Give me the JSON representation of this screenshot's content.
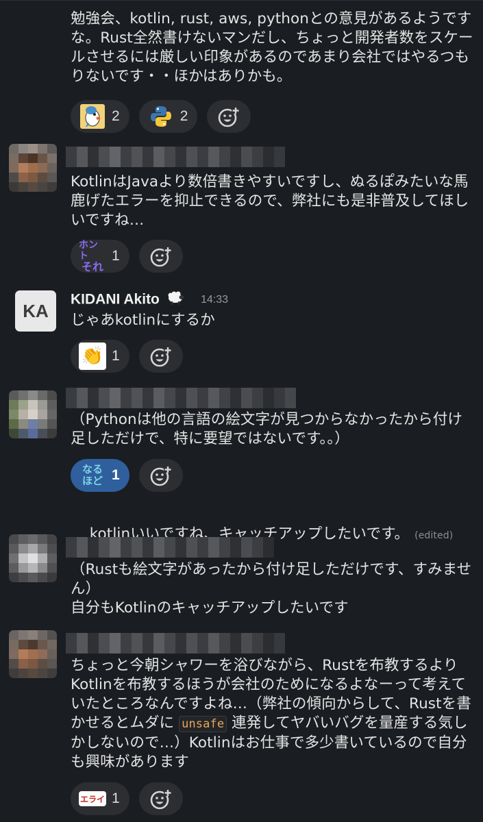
{
  "messages": {
    "m1": {
      "text": "勉強会、kotlin, rust, aws, pythonとの意見があるようですな。Rust全然書けないマンだし、ちょっと開発者数をスケールさせるには厳しい印象があるのであまり会社ではやるつもりないです・・ほかはありかも。",
      "reactions": [
        {
          "emoji": "parrot-emoji",
          "count": "2"
        },
        {
          "emoji": "python-emoji",
          "count": "2"
        }
      ]
    },
    "m2": {
      "text": "KotlinはJavaより数倍書きやすいですし、ぬるぽみたいな馬鹿げたエラーを抑止できるので、弊社にも是非普及してほしいですね…",
      "reactions": [
        {
          "emoji": "honto-sore-emoji",
          "label_line1": "ホント",
          "label_line2": "それ",
          "count": "1"
        }
      ]
    },
    "m3": {
      "avatar_initials": "KA",
      "sender": "KIDANI Akito",
      "time": "14:33",
      "text": "じゃあkotlinにするか",
      "reactions": [
        {
          "emoji": "clap-emoji",
          "glyph": "👏",
          "count": "1"
        }
      ]
    },
    "m4": {
      "text": "（Pythonは他の言語の絵文字が見つからなかったから付け足しただけで、特に要望ではないです。。）",
      "reactions": [
        {
          "emoji": "naruhodo-emoji",
          "label_line1": "なる",
          "label_line2": "ほど",
          "count": "1"
        }
      ],
      "followup_text": "kotlinいいですね、キャッチアップしたいです。",
      "edited_label": "(edited)"
    },
    "m5": {
      "text": "（Rustも絵文字があったから付け足しただけです、すみません）\n自分もKotlinのキャッチアップしたいです"
    },
    "m6": {
      "text_before": "ちょっと今朝シャワーを浴びながら、Rustを布教するよりKotlinを布教するほうが会社のためになるよなーって考えていたところなんですよね…（弊社の傾向からして、Rustを書かせるとムダに",
      "code": "unsafe",
      "text_after": "連発してヤバいバグを量産する気しかしないので…）Kotlinはお仕事で多少書いているので自分も興味があります",
      "reactions": [
        {
          "emoji": "erai-emoji",
          "label": "エライ",
          "count": "1"
        }
      ]
    }
  },
  "icons": {
    "add_reaction": "add-reaction-icon",
    "sheep": "sheep-emoji"
  },
  "colors": {
    "background": "#1a1d21",
    "pill": "#2c2e32",
    "pill_selected": "#2f5f9d",
    "text": "#e4e4e4"
  }
}
